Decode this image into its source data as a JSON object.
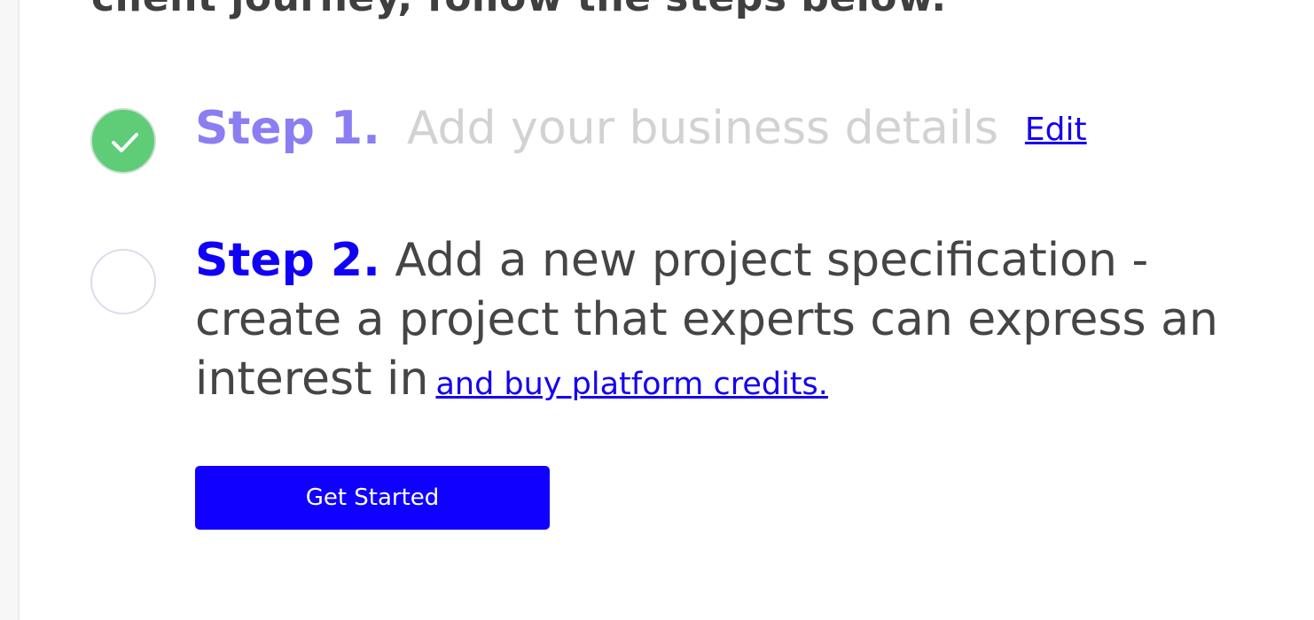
{
  "intro_text": "client journey, follow the steps below.",
  "steps": [
    {
      "number_label": "Step 1.",
      "description": "Add your business details",
      "action_link": "Edit",
      "status": "complete",
      "status_color": "#5fcc77"
    },
    {
      "number_label": "Step 2.",
      "description_line1": "Add a new project specification -",
      "description_line2": "create a project that experts can express an",
      "description_line3": "interest in",
      "action_link": "and buy platform credits.",
      "status": "incomplete"
    }
  ],
  "cta_button": "Get Started",
  "colors": {
    "accent_blue": "#1000ff",
    "step1_label": "#8a7ef2",
    "complete_green": "#5fcc77",
    "muted_text": "#d2d2d2",
    "body_text": "#454545"
  },
  "icons": {
    "step1": "checkmark-icon",
    "step2": "empty-circle-icon"
  }
}
